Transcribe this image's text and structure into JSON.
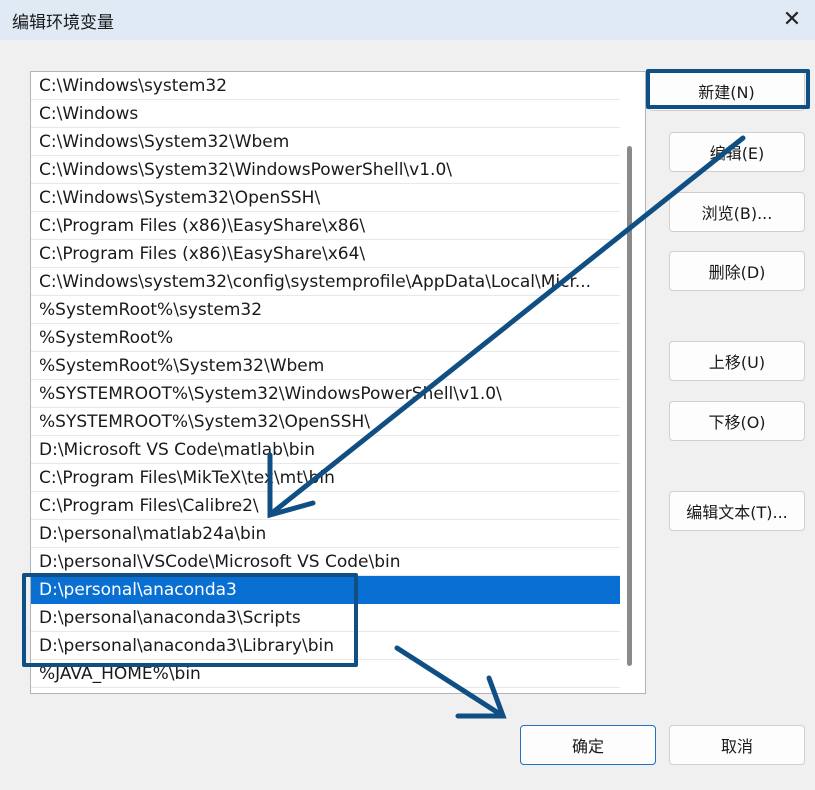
{
  "window": {
    "title": "编辑环境变量",
    "close_label": "✕"
  },
  "path_list": {
    "selected_index": 18,
    "items": [
      "C:\\Windows\\system32",
      "C:\\Windows",
      "C:\\Windows\\System32\\Wbem",
      "C:\\Windows\\System32\\WindowsPowerShell\\v1.0\\",
      "C:\\Windows\\System32\\OpenSSH\\",
      "C:\\Program Files (x86)\\EasyShare\\x86\\",
      "C:\\Program Files (x86)\\EasyShare\\x64\\",
      "C:\\Windows\\system32\\config\\systemprofile\\AppData\\Local\\Micr...",
      "%SystemRoot%\\system32",
      "%SystemRoot%",
      "%SystemRoot%\\System32\\Wbem",
      "%SYSTEMROOT%\\System32\\WindowsPowerShell\\v1.0\\",
      "%SYSTEMROOT%\\System32\\OpenSSH\\",
      "D:\\Microsoft VS Code\\matlab\\bin",
      "C:\\Program Files\\MikTeX\\tex\\mt\\bin",
      "C:\\Program Files\\Calibre2\\",
      "D:\\personal\\matlab24a\\bin",
      "D:\\personal\\VSCode\\Microsoft VS Code\\bin",
      "D:\\personal\\anaconda3",
      "D:\\personal\\anaconda3\\Scripts",
      "D:\\personal\\anaconda3\\Library\\bin",
      "%JAVA_HOME%\\bin"
    ]
  },
  "buttons": {
    "new": "新建(N)",
    "edit": "编辑(E)",
    "browse": "浏览(B)...",
    "delete": "删除(D)",
    "move_up": "上移(U)",
    "move_down": "下移(O)",
    "edit_text": "编辑文本(T)...",
    "ok": "确定",
    "cancel": "取消"
  },
  "colors": {
    "selection": "#0a6fd3",
    "annotation": "#0f4f84",
    "title_bar": "#dfeaf4"
  }
}
